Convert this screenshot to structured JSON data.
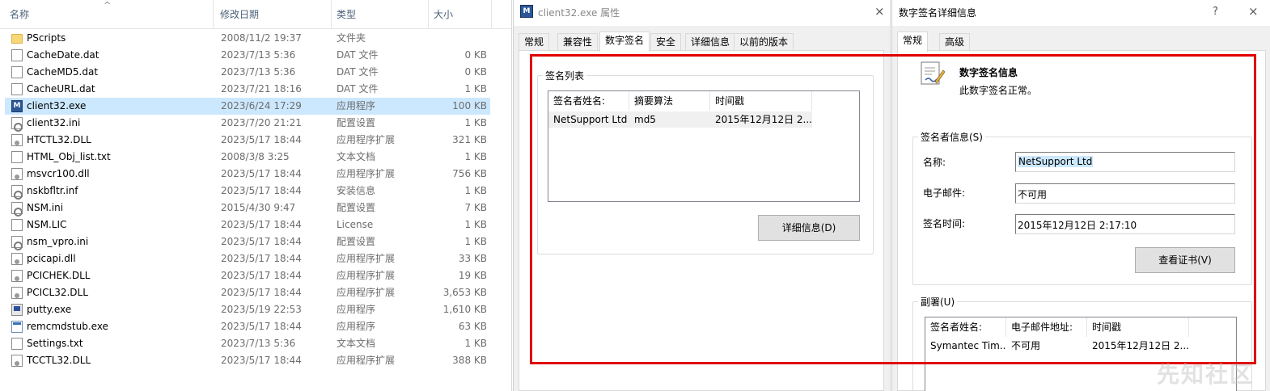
{
  "explorer": {
    "columns": {
      "name": "名称",
      "date": "修改日期",
      "type": "类型",
      "size": "大小"
    },
    "sort_indicator": "^",
    "files": [
      {
        "icon": "folder-icon",
        "name": "PScripts",
        "date": "2008/11/2 19:37",
        "type": "文件夹",
        "size": ""
      },
      {
        "icon": "document-icon",
        "name": "CacheDate.dat",
        "date": "2023/7/13 5:36",
        "type": "DAT 文件",
        "size": "0 KB"
      },
      {
        "icon": "document-icon",
        "name": "CacheMD5.dat",
        "date": "2023/7/13 5:36",
        "type": "DAT 文件",
        "size": "0 KB"
      },
      {
        "icon": "document-icon",
        "name": "CacheURL.dat",
        "date": "2023/7/21 18:16",
        "type": "DAT 文件",
        "size": "1 KB"
      },
      {
        "icon": "exe-icon",
        "name": "client32.exe",
        "date": "2023/6/24 17:29",
        "type": "应用程序",
        "size": "100 KB",
        "selected": true
      },
      {
        "icon": "settings-icon",
        "name": "client32.ini",
        "date": "2023/7/20 21:21",
        "type": "配置设置",
        "size": "1 KB"
      },
      {
        "icon": "dll-icon",
        "name": "HTCTL32.DLL",
        "date": "2023/5/17 18:44",
        "type": "应用程序扩展",
        "size": "321 KB"
      },
      {
        "icon": "document-icon",
        "name": "HTML_Obj_list.txt",
        "date": "2008/3/8 3:25",
        "type": "文本文档",
        "size": "1 KB"
      },
      {
        "icon": "dll-icon",
        "name": "msvcr100.dll",
        "date": "2023/5/17 18:44",
        "type": "应用程序扩展",
        "size": "756 KB"
      },
      {
        "icon": "settings-icon",
        "name": "nskbfltr.inf",
        "date": "2023/5/17 18:44",
        "type": "安装信息",
        "size": "1 KB"
      },
      {
        "icon": "settings-icon",
        "name": "NSM.ini",
        "date": "2015/4/30 9:47",
        "type": "配置设置",
        "size": "7 KB"
      },
      {
        "icon": "document-icon",
        "name": "NSM.LIC",
        "date": "2023/5/17 18:44",
        "type": "License",
        "size": "1 KB"
      },
      {
        "icon": "settings-icon",
        "name": "nsm_vpro.ini",
        "date": "2023/5/17 18:44",
        "type": "配置设置",
        "size": "1 KB"
      },
      {
        "icon": "dll-icon",
        "name": "pcicapi.dll",
        "date": "2023/5/17 18:44",
        "type": "应用程序扩展",
        "size": "33 KB"
      },
      {
        "icon": "dll-icon",
        "name": "PCICHEK.DLL",
        "date": "2023/5/17 18:44",
        "type": "应用程序扩展",
        "size": "19 KB"
      },
      {
        "icon": "dll-icon",
        "name": "PCICL32.DLL",
        "date": "2023/5/17 18:44",
        "type": "应用程序扩展",
        "size": "3,653 KB"
      },
      {
        "icon": "putty-icon",
        "name": "putty.exe",
        "date": "2023/5/19 22:53",
        "type": "应用程序",
        "size": "1,610 KB"
      },
      {
        "icon": "window-icon",
        "name": "remcmdstub.exe",
        "date": "2023/5/17 18:44",
        "type": "应用程序",
        "size": "63 KB"
      },
      {
        "icon": "document-icon",
        "name": "Settings.txt",
        "date": "2023/7/13 5:36",
        "type": "文本文档",
        "size": "1 KB"
      },
      {
        "icon": "dll-icon",
        "name": "TCCTL32.DLL",
        "date": "2023/5/17 18:44",
        "type": "应用程序扩展",
        "size": "388 KB"
      }
    ]
  },
  "props": {
    "title": "client32.exe 属性",
    "close": "×",
    "app_icon_letter": "M",
    "tabs": [
      "常规",
      "兼容性",
      "数字签名",
      "安全",
      "详细信息",
      "以前的版本"
    ],
    "group_label": "签名列表",
    "list_headers": [
      "签名者姓名:",
      "摘要算法",
      "时间戳"
    ],
    "list_row": [
      "NetSupport Ltd",
      "md5",
      "2015年12月12日 2..."
    ],
    "details_button": "详细信息(D)"
  },
  "details": {
    "title": "数字签名详细信息",
    "help": "?",
    "close": "×",
    "tabs": [
      "常规",
      "高级"
    ],
    "info_title": "数字签名信息",
    "info_status": "此数字签名正常。",
    "signer_group": "签名者信息(S)",
    "name_label": "名称:",
    "name_value": "NetSupport Ltd",
    "email_label": "电子邮件:",
    "email_value": "不可用",
    "time_label": "签名时间:",
    "time_value": "2015年12月12日 2:17:10",
    "view_cert_button": "查看证书(V)",
    "countersig_group": "副署(U)",
    "counter_headers": [
      "签名者姓名:",
      "电子邮件地址:",
      "时间戳"
    ],
    "counter_row": [
      "Symantec Tim...",
      "不可用",
      "2015年12月12日 2..."
    ]
  },
  "colors": {
    "highlight_box": "#e00000",
    "selection": "#cce8ff"
  },
  "watermark": "先知社区"
}
